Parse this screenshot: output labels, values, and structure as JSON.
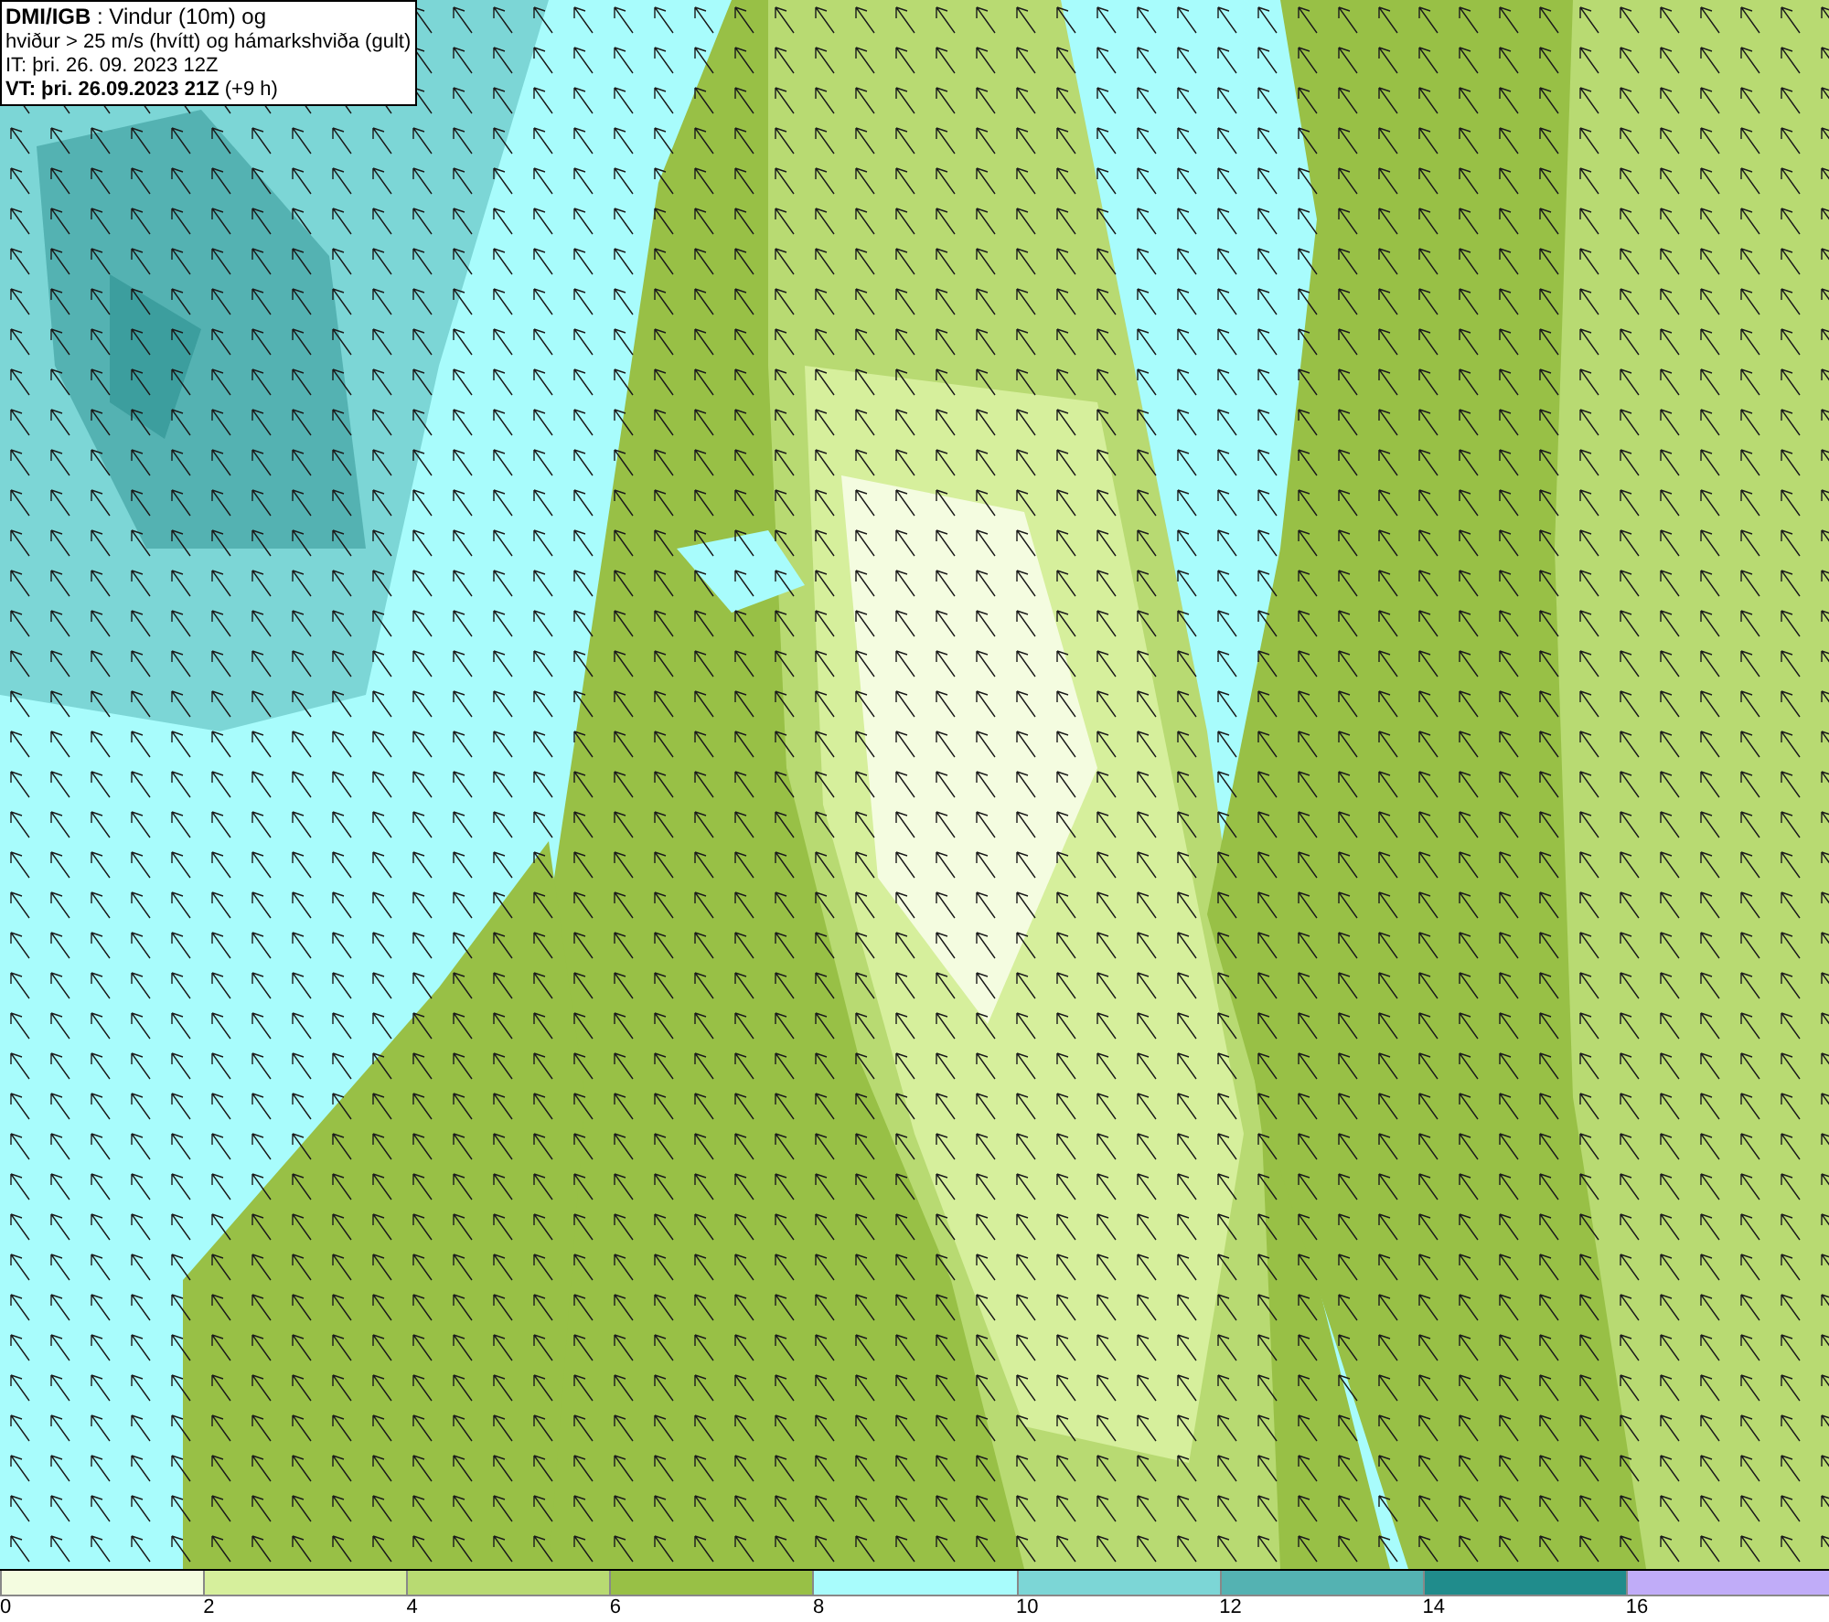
{
  "title_box": {
    "lines": [
      "**DMI/IGB** : Vindur (10m) og",
      "hviður > 25 m/s (hvítt) og hámarkshviða (gult)",
      "IT: þri. 26. 09. 2023 12Z",
      "**VT: þri. 26.09.2023 21Z** (+9 h)"
    ]
  },
  "legend": [
    {
      "label": "0",
      "color": "#f4fce0"
    },
    {
      "label": "2",
      "color": "#d6ef9c"
    },
    {
      "label": "4",
      "color": "#b8da72"
    },
    {
      "label": "6",
      "color": "#98c046"
    },
    {
      "label": "8",
      "color": "#a8fcfc"
    },
    {
      "label": "10",
      "color": "#7cd6d6"
    },
    {
      "label": "12",
      "color": "#54b2b2"
    },
    {
      "label": "14",
      "color": "#208c8c"
    },
    {
      "label": "16",
      "color": "#c0acf8"
    }
  ]
}
